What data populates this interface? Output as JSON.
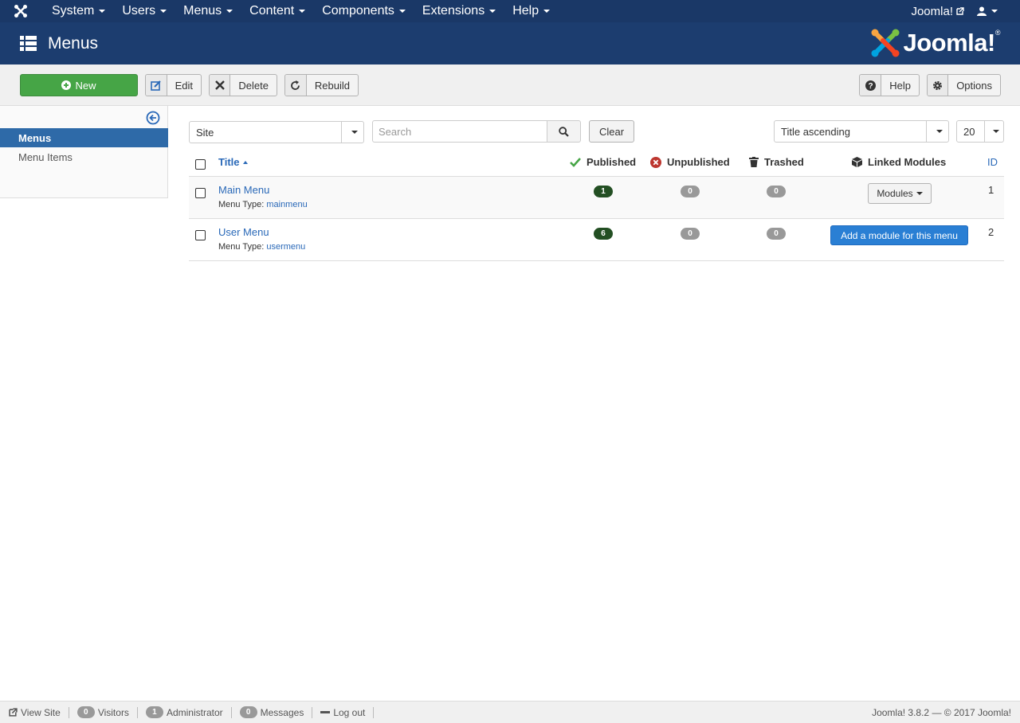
{
  "topnav": {
    "brand_icon": "joomla-icon",
    "items": [
      {
        "label": "System"
      },
      {
        "label": "Users"
      },
      {
        "label": "Menus"
      },
      {
        "label": "Content"
      },
      {
        "label": "Components"
      },
      {
        "label": "Extensions"
      },
      {
        "label": "Help"
      }
    ],
    "site_link": "Joomla!",
    "user_icon": "user-icon"
  },
  "header": {
    "title": "Menus",
    "logo_text": "Joomla!",
    "logo_mark": "®"
  },
  "toolbar": {
    "new_label": "New",
    "edit_label": "Edit",
    "delete_label": "Delete",
    "rebuild_label": "Rebuild",
    "help_label": "Help",
    "options_label": "Options"
  },
  "sidebar": {
    "items": [
      {
        "label": "Menus",
        "active": true
      },
      {
        "label": "Menu Items",
        "active": false
      }
    ]
  },
  "filters": {
    "client": "Site",
    "search_placeholder": "Search",
    "clear_label": "Clear",
    "ordering": "Title ascending",
    "limit": "20"
  },
  "table": {
    "headers": {
      "title": "Title",
      "published": "Published",
      "unpublished": "Unpublished",
      "trashed": "Trashed",
      "linked_modules": "Linked Modules",
      "id": "ID"
    },
    "menu_type_label": "Menu Type:",
    "rows": [
      {
        "title": "Main Menu",
        "menu_type": "mainmenu",
        "published": "1",
        "unpublished": "0",
        "trashed": "0",
        "modules_action": "Modules",
        "id": "1"
      },
      {
        "title": "User Menu",
        "menu_type": "usermenu",
        "published": "6",
        "unpublished": "0",
        "trashed": "0",
        "modules_action": "Add a module for this menu",
        "id": "2"
      }
    ]
  },
  "footer": {
    "view_site": "View Site",
    "visitors_count": "0",
    "visitors_label": "Visitors",
    "admin_count": "1",
    "admin_label": "Administrator",
    "messages_count": "0",
    "messages_label": "Messages",
    "logout": "Log out",
    "version": "Joomla! 3.8.2 — © 2017 Joomla!"
  },
  "colors": {
    "nav_bg": "#1a3867",
    "header_bg": "#1c3d6f",
    "new_button": "#46a546",
    "link": "#2a69b8",
    "published_badge": "#234f23",
    "add_module_button": "#2a7fd4"
  }
}
